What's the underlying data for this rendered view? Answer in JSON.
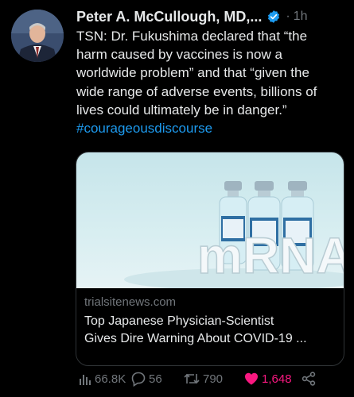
{
  "tweet": {
    "author_name": "Peter A. McCullough, MD,...",
    "separator": "·",
    "time": "1h",
    "text_lines": [
      "TSN:  Dr. Fukushima declared that “the",
      "harm caused by vaccines is now a",
      "worldwide problem” and that “given the",
      "wide range of adverse events, billions of",
      "lives could ultimately  be in danger.”"
    ],
    "hashtag": "#courageousdiscourse"
  },
  "card": {
    "image_text": "mRNA",
    "domain": "trialsitenews.com",
    "headline_lines": [
      "Top Japanese Physician-Scientist",
      "Gives Dire Warning About COVID-19 ..."
    ]
  },
  "actions": {
    "views": "66.8K",
    "replies": "56",
    "retweets": "790",
    "likes": "1,648"
  },
  "colors": {
    "background": "#000000",
    "text": "#e7e9ea",
    "muted": "#71767b",
    "link": "#1d9bf0",
    "like": "#f91880",
    "verified": "#1d9bf0"
  },
  "icons": {
    "verified": "verified-badge-icon",
    "views": "bar-chart-icon",
    "reply": "speech-bubble-icon",
    "retweet": "retweet-arrows-icon",
    "like": "heart-filled-icon",
    "share": "share-icon"
  }
}
